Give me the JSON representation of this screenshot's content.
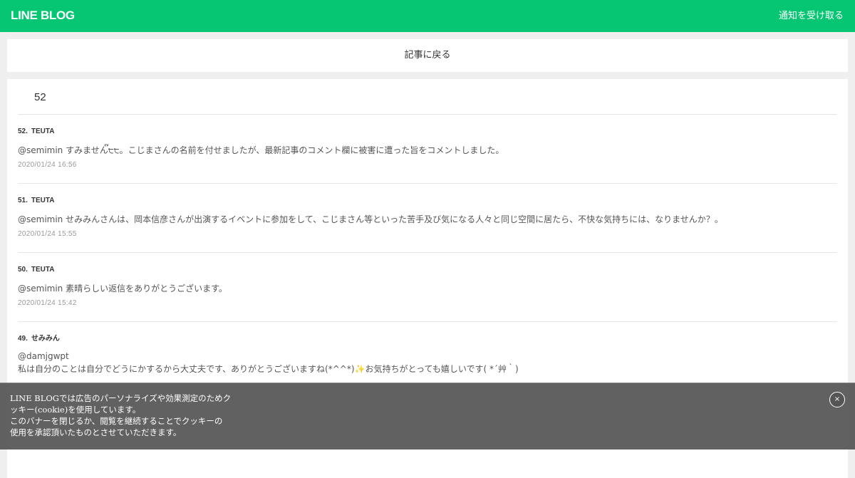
{
  "header": {
    "logo": "LINE BLOG",
    "notify_label": "通知を受け取る"
  },
  "back": {
    "label": "記事に戻る"
  },
  "comments": {
    "count": "52",
    "items": [
      {
        "number": "52.",
        "author": "TEUTA",
        "text": "@semimin すみません๊੮੮。こじまさんの名前を付せましたが、最新記事のコメント欄に被害に遭った旨をコメントしました。",
        "date": "2020/01/24 16:56"
      },
      {
        "number": "51.",
        "author": "TEUTA",
        "text": "@semimin せみみんさんは、岡本信彦さんが出演するイベントに参加をして、こじまさん等といった苦手及び気になる人々と同じ空間に居たら、不快な気持ちには、なりませんか？。",
        "date": "2020/01/24 15:55"
      },
      {
        "number": "50.",
        "author": "TEUTA",
        "text": "@semimin 素晴らしい返信をありがとうございます。",
        "date": "2020/01/24 15:42"
      },
      {
        "number": "49.",
        "author": "せみみん",
        "text": "@damjgwpt\n私は自分のことは自分でどうにかするから大丈夫です、ありがとうございますね(*^^*)✨お気持ちがとっても嬉しいです( *´艸｀)",
        "date": ""
      }
    ]
  },
  "cookie_banner": {
    "line1": "LINE BLOGでは広告のパーソナライズや効果測定のためク",
    "line2": "ッキー(cookie)を使用しています。",
    "line3": "このバナーを閉じるか、閲覧を継続することでクッキーの",
    "line4": "使用を承認頂いたものとさせていただきます。",
    "close_symbol": "×"
  },
  "colors": {
    "brand": "#06c674",
    "banner_bg": "#555555"
  }
}
